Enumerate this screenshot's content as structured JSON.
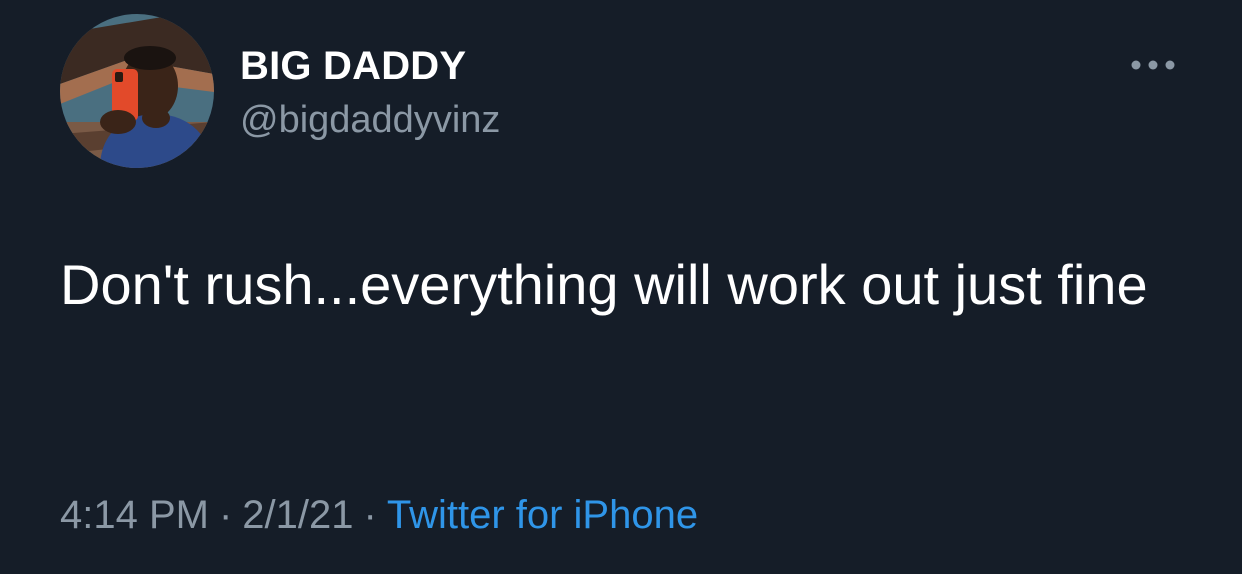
{
  "author": {
    "display_name": "BIG DADDY",
    "handle": "@bigdaddyvinz",
    "avatar_icon": "profile-photo"
  },
  "header": {
    "more_icon": "more-horizontal-icon"
  },
  "tweet": {
    "text": "Don't rush...everything will work out just fine",
    "time": "4:14 PM",
    "date": "2/1/21",
    "separator": "·",
    "source": "Twitter for iPhone"
  },
  "colors": {
    "background": "#151d28",
    "primary_text": "#ffffff",
    "secondary_text": "#8b98a5",
    "link": "#2f95e8"
  }
}
